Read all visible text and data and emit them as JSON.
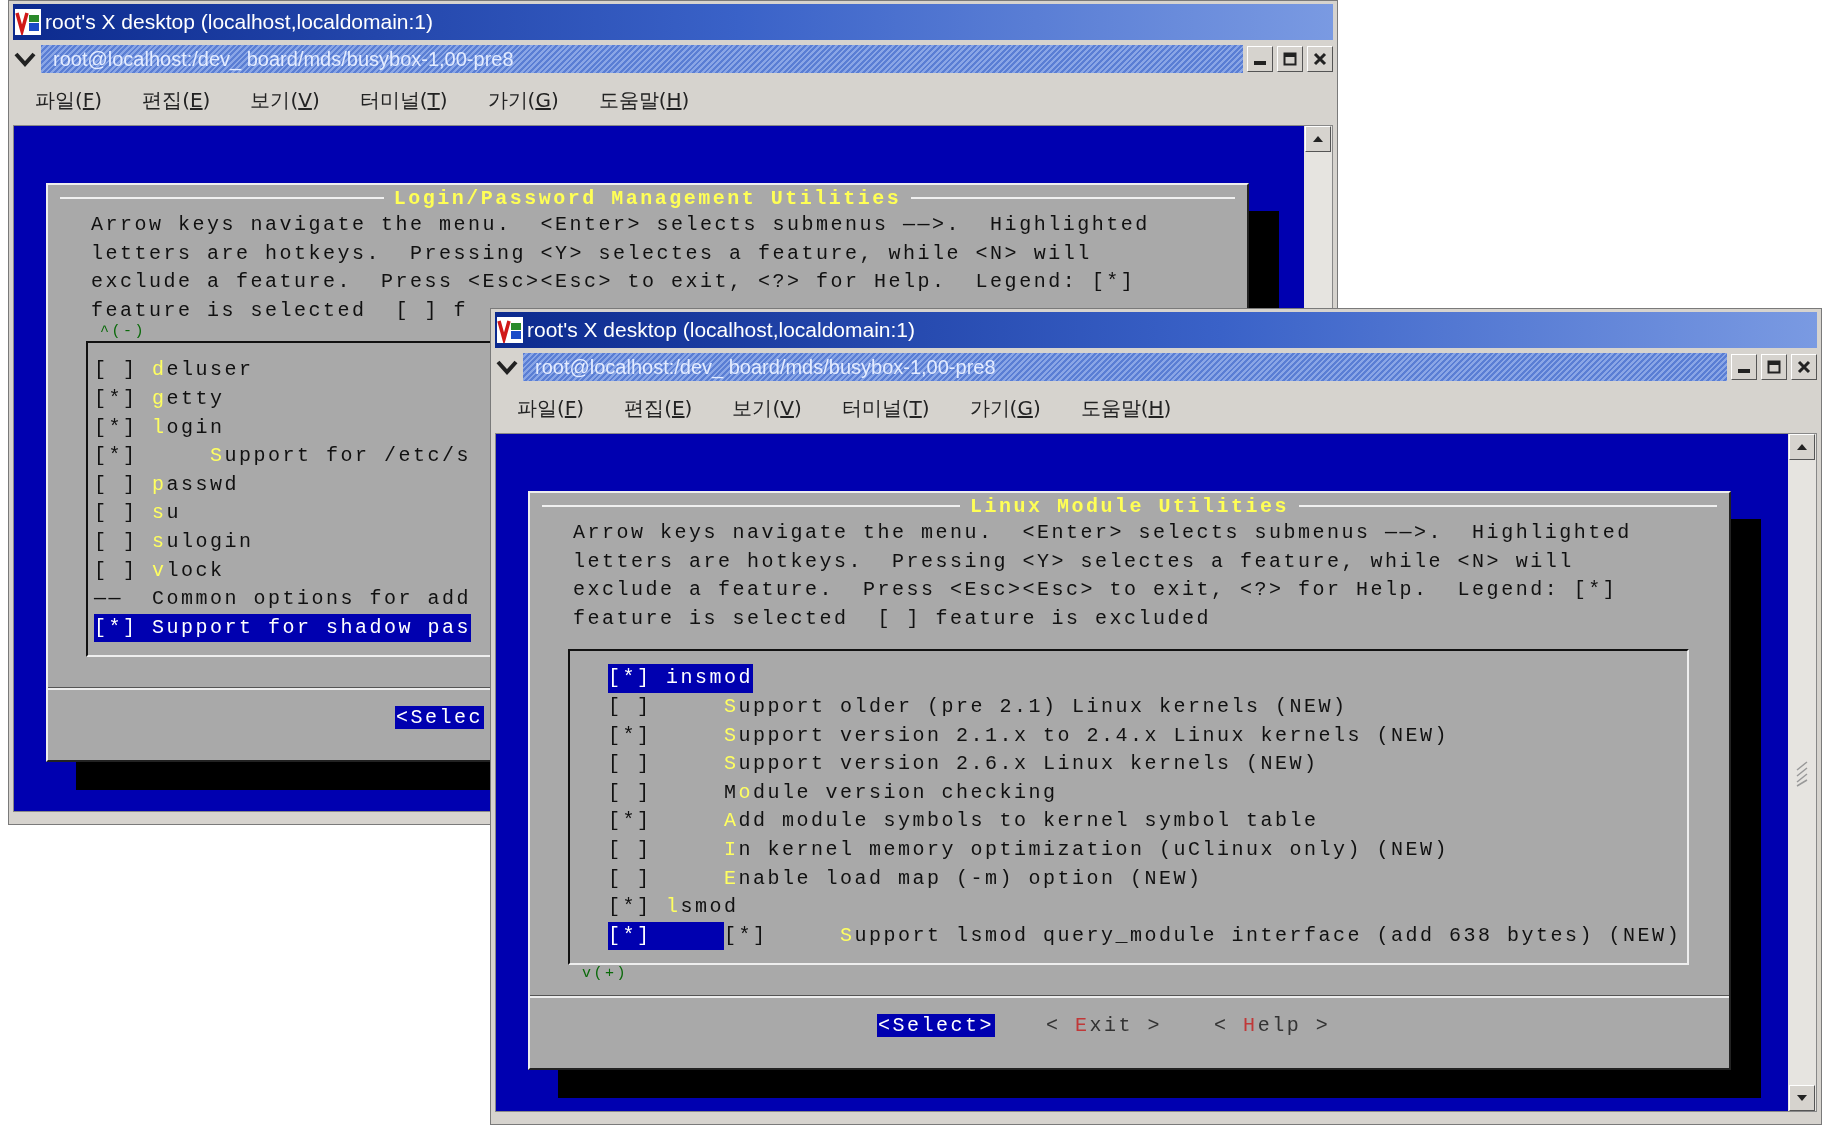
{
  "windows": [
    {
      "title": "root's X desktop (localhost,localdomain:1)",
      "terminal_title": "root@localhost:/dev_ board/mds/busybox-1,00-pre8",
      "menu": [
        {
          "text": "파일(",
          "key": "F",
          "end": ")"
        },
        {
          "text": "편집(",
          "key": "E",
          "end": ")"
        },
        {
          "text": "보기(",
          "key": "V",
          "end": ")"
        },
        {
          "text": "터미널(",
          "key": "T",
          "end": ")"
        },
        {
          "text": "가기(",
          "key": "G",
          "end": ")"
        },
        {
          "text": "도움말(",
          "key": "H",
          "end": ")"
        }
      ],
      "dialog": {
        "title": "Login/Password Management Utilities",
        "help": [
          "Arrow keys navigate the menu.  <Enter> selects submenus ——>.  Highlighted",
          "letters are hotkeys.  Pressing <Y> selectes a feature, while <N> will",
          "exclude a feature.  Press <Esc><Esc> to exit, <?> for Help.  Legend: [*]",
          "feature is selected  [ ] f"
        ],
        "more": {
          "text": "^(-)",
          "kind": "top"
        },
        "items": [
          {
            "kind": "option",
            "box": "[ ]",
            "hot": "d",
            "rest": "eluser",
            "selected": false
          },
          {
            "kind": "option",
            "box": "[*]",
            "hot": "g",
            "rest": "etty",
            "selected": false
          },
          {
            "kind": "option",
            "box": "[*]",
            "hot": "l",
            "rest": "ogin",
            "selected": false,
            "children": [
              {
                "kind": "option",
                "box": "[*]",
                "hot": "S",
                "rest": "upport for /etc/s",
                "selected": false
              }
            ]
          },
          {
            "kind": "option",
            "box": "[ ]",
            "hot": "p",
            "rest": "asswd",
            "selected": false
          },
          {
            "kind": "option",
            "box": "[ ]",
            "hot": "s",
            "rest": "u",
            "selected": false
          },
          {
            "kind": "option",
            "box": "[ ]",
            "hot": "s",
            "rest": "ulogin",
            "selected": false
          },
          {
            "kind": "option",
            "box": "[ ]",
            "hot": "v",
            "rest": "lock",
            "selected": false
          },
          {
            "kind": "comment",
            "box": "——",
            "rest": "Common options for add",
            "selected": false
          },
          {
            "kind": "option",
            "box": "[*]",
            "rest": "Support for shadow pas",
            "selected": true
          }
        ],
        "buttons": [
          {
            "pre": "<",
            "hot": "S",
            "rest": "elec",
            "selected": true
          }
        ]
      }
    },
    {
      "title": "root's X desktop (localhost,localdomain:1)",
      "terminal_title": "root@localhost:/dev_ board/mds/busybox-1,00-pre8",
      "menu": [
        {
          "text": "파일(",
          "key": "F",
          "end": ")"
        },
        {
          "text": "편집(",
          "key": "E",
          "end": ")"
        },
        {
          "text": "보기(",
          "key": "V",
          "end": ")"
        },
        {
          "text": "터미널(",
          "key": "T",
          "end": ")"
        },
        {
          "text": "가기(",
          "key": "G",
          "end": ")"
        },
        {
          "text": "도움말(",
          "key": "H",
          "end": ")"
        }
      ],
      "dialog": {
        "title": "Linux Module Utilities",
        "help": [
          "Arrow keys navigate the menu.  <Enter> selects submenus ——>.  Highlighted",
          "letters are hotkeys.  Pressing <Y> selectes a feature, while <N> will",
          "exclude a feature.  Press <Esc><Esc> to exit, <?> for Help.  Legend: [*]",
          "feature is selected  [ ] feature is excluded"
        ],
        "more": {
          "text": "v(+)",
          "kind": "bottom"
        },
        "items": [
          {
            "kind": "option",
            "box": "[*]",
            "rest": "insmod",
            "selected": true,
            "children": [
              {
                "kind": "option",
                "box": "[ ]",
                "hot": "S",
                "rest": "upport older (pre 2.1) Linux kernels (NEW)",
                "selected": false
              },
              {
                "kind": "option",
                "box": "[*]",
                "hot": "S",
                "rest": "upport version 2.1.x to 2.4.x Linux kernels (NEW)",
                "selected": false
              },
              {
                "kind": "option",
                "box": "[ ]",
                "hot": "S",
                "rest": "upport version 2.6.x Linux kernels (NEW)",
                "selected": false
              },
              {
                "kind": "option",
                "box": "[ ]",
                "pre": "M",
                "hot": "o",
                "rest": "dule version checking",
                "selected": false
              },
              {
                "kind": "option",
                "box": "[*]",
                "hot": "A",
                "rest": "dd module symbols to kernel symbol table",
                "selected": false
              },
              {
                "kind": "option",
                "box": "[ ]",
                "hot": "I",
                "rest": "n kernel memory optimization (uClinux only) (NEW)",
                "selected": false
              },
              {
                "kind": "option",
                "box": "[ ]",
                "hot": "E",
                "rest": "nable load map (-m) option (NEW)",
                "selected": false
              }
            ]
          },
          {
            "kind": "option",
            "box": "[*]",
            "hot": "l",
            "rest": "smod",
            "selected": false,
            "children": [
              {
                "kind": "option",
                "box": "[*]",
                "sub_box": "[*]",
                "hot": "S",
                "rest": "upport lsmod query_module interface (add 638 bytes) (NEW)",
                "selected": true
              }
            ]
          }
        ],
        "buttons": [
          {
            "pre": "<",
            "hot": "S",
            "rest": "elect>",
            "selected": true
          },
          {
            "pre": "< ",
            "hot": "E",
            "rest": "xit >",
            "selected": false
          },
          {
            "pre": "< ",
            "hot": "H",
            "rest": "elp >",
            "selected": false
          }
        ]
      }
    }
  ]
}
